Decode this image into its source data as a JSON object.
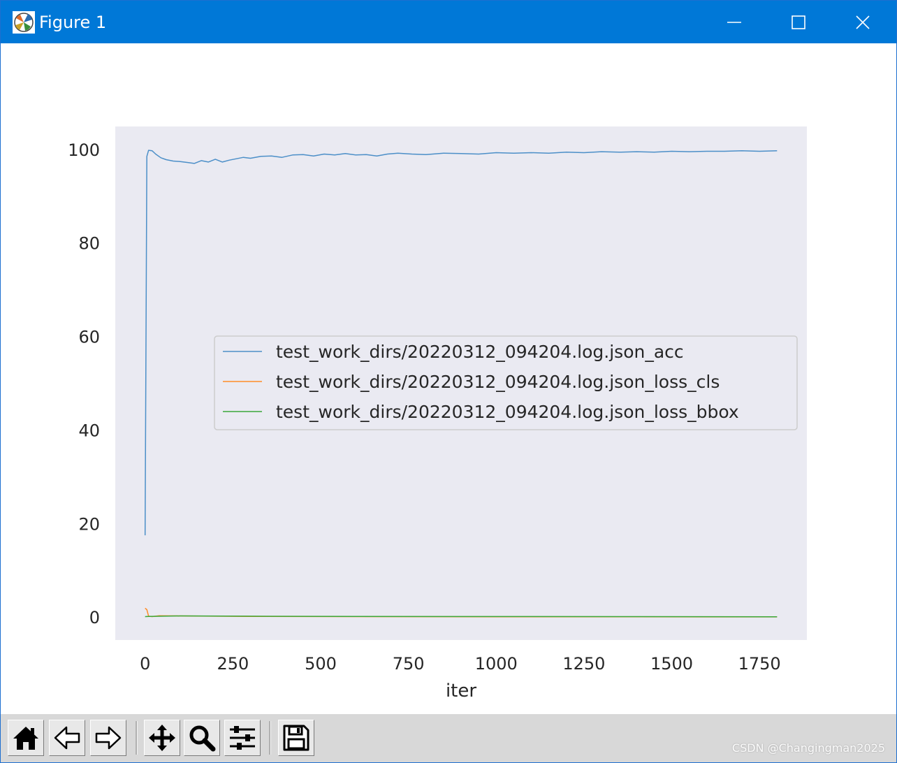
{
  "window": {
    "title": "Figure 1",
    "icon": "matplotlib-logo-icon",
    "controls": [
      "minimize-icon",
      "maximize-icon",
      "close-icon"
    ],
    "titlebar_color": "#0078d7"
  },
  "toolbar": {
    "buttons": [
      {
        "name": "home-button",
        "icon": "home-icon"
      },
      {
        "name": "back-button",
        "icon": "arrow-left-icon"
      },
      {
        "name": "forward-button",
        "icon": "arrow-right-icon"
      },
      {
        "name": "pan-button",
        "icon": "move-arrows-icon"
      },
      {
        "name": "zoom-button",
        "icon": "magnifier-icon"
      },
      {
        "name": "configure-subplots-button",
        "icon": "sliders-icon"
      },
      {
        "name": "save-button",
        "icon": "floppy-disk-icon"
      }
    ]
  },
  "watermark": "CSDN @Changingman2025",
  "chart_data": {
    "type": "line",
    "xlabel": "iter",
    "ylabel": "",
    "title": "",
    "xlim": [
      -85,
      1885
    ],
    "ylim": [
      -4.9,
      104.9
    ],
    "xticks": [
      0,
      250,
      500,
      750,
      1000,
      1250,
      1500,
      1750
    ],
    "xtick_labels": [
      "0",
      "250",
      "500",
      "750",
      "1000",
      "1250",
      "1500",
      "1750"
    ],
    "yticks": [
      0,
      20,
      40,
      60,
      80,
      100
    ],
    "ytick_labels": [
      "0",
      "20",
      "40",
      "60",
      "80",
      "100"
    ],
    "grid": false,
    "background": "#eaeaf2",
    "legend_position": "center-right",
    "series": [
      {
        "name": "test_work_dirs/20220312_094204.log.json_acc",
        "color": "#4c8fc8",
        "x": [
          0,
          5,
          10,
          20,
          30,
          45,
          60,
          80,
          100,
          120,
          140,
          160,
          180,
          200,
          220,
          240,
          260,
          280,
          300,
          330,
          360,
          390,
          420,
          450,
          480,
          510,
          540,
          570,
          600,
          630,
          660,
          690,
          720,
          760,
          800,
          850,
          900,
          950,
          1000,
          1050,
          1100,
          1150,
          1200,
          1250,
          1300,
          1350,
          1400,
          1450,
          1500,
          1550,
          1600,
          1650,
          1700,
          1750,
          1800
        ],
        "y": [
          17.5,
          98.5,
          99.8,
          99.7,
          99.0,
          98.2,
          97.8,
          97.5,
          97.4,
          97.2,
          97.0,
          97.6,
          97.3,
          97.9,
          97.3,
          97.7,
          98.0,
          98.3,
          98.1,
          98.5,
          98.6,
          98.3,
          98.8,
          98.9,
          98.6,
          99.0,
          98.8,
          99.1,
          98.8,
          98.9,
          98.6,
          99.0,
          99.2,
          99.0,
          98.9,
          99.2,
          99.1,
          99.0,
          99.3,
          99.2,
          99.3,
          99.2,
          99.4,
          99.3,
          99.5,
          99.4,
          99.5,
          99.4,
          99.6,
          99.5,
          99.6,
          99.6,
          99.7,
          99.6,
          99.7
        ]
      },
      {
        "name": "test_work_dirs/20220312_094204.log.json_loss_cls",
        "color": "#ff8c28",
        "x": [
          0,
          5,
          10,
          20,
          40,
          100,
          300,
          600,
          1000,
          1400,
          1800
        ],
        "y": [
          1.9,
          1.6,
          0.2,
          0.1,
          0.3,
          0.25,
          0.15,
          0.1,
          0.08,
          0.06,
          0.05
        ]
      },
      {
        "name": "test_work_dirs/20220312_094204.log.json_loss_bbox",
        "color": "#3aa83a",
        "x": [
          0,
          10,
          50,
          100,
          300,
          600,
          1000,
          1400,
          1800
        ],
        "y": [
          0.1,
          0.15,
          0.2,
          0.25,
          0.2,
          0.15,
          0.12,
          0.1,
          0.08
        ]
      }
    ]
  }
}
